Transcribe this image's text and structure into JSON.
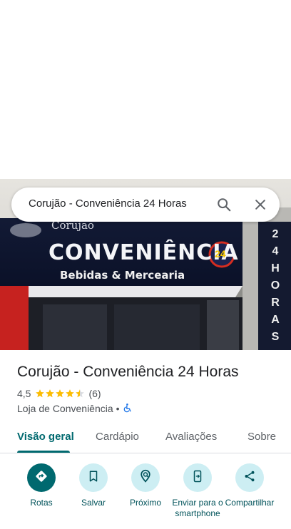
{
  "search": {
    "query": "Corujão - Conveniência 24 Horas"
  },
  "hero": {
    "sign_main": "CONVENIÊNCIA",
    "sign_sub": "Bebidas & Mercearia",
    "sign_brand": "Corujão",
    "badge": "24",
    "vertical_sign": [
      "2",
      "4",
      "H",
      "O",
      "R",
      "A",
      "S"
    ]
  },
  "place": {
    "name": "Corujão - Conveniência 24 Horas",
    "rating": "4,5",
    "rating_value": 4.5,
    "review_count": "(6)",
    "category": "Loja de Conveniência",
    "separator": "•"
  },
  "tabs": [
    {
      "label": "Visão geral",
      "active": true
    },
    {
      "label": "Cardápio",
      "active": false
    },
    {
      "label": "Avaliações",
      "active": false
    },
    {
      "label": "Sobre",
      "active": false
    }
  ],
  "actions": [
    {
      "label": "Rotas",
      "icon": "directions-icon"
    },
    {
      "label": "Salvar",
      "icon": "bookmark-icon"
    },
    {
      "label": "Próximo",
      "icon": "nearby-icon"
    },
    {
      "label": "Enviar para o smartphone",
      "icon": "send-to-phone-icon"
    },
    {
      "label": "Compartilhar",
      "icon": "share-icon"
    }
  ],
  "colors": {
    "accent": "#00696f",
    "action_bg": "#cdeef3",
    "star": "#fbbc04"
  }
}
